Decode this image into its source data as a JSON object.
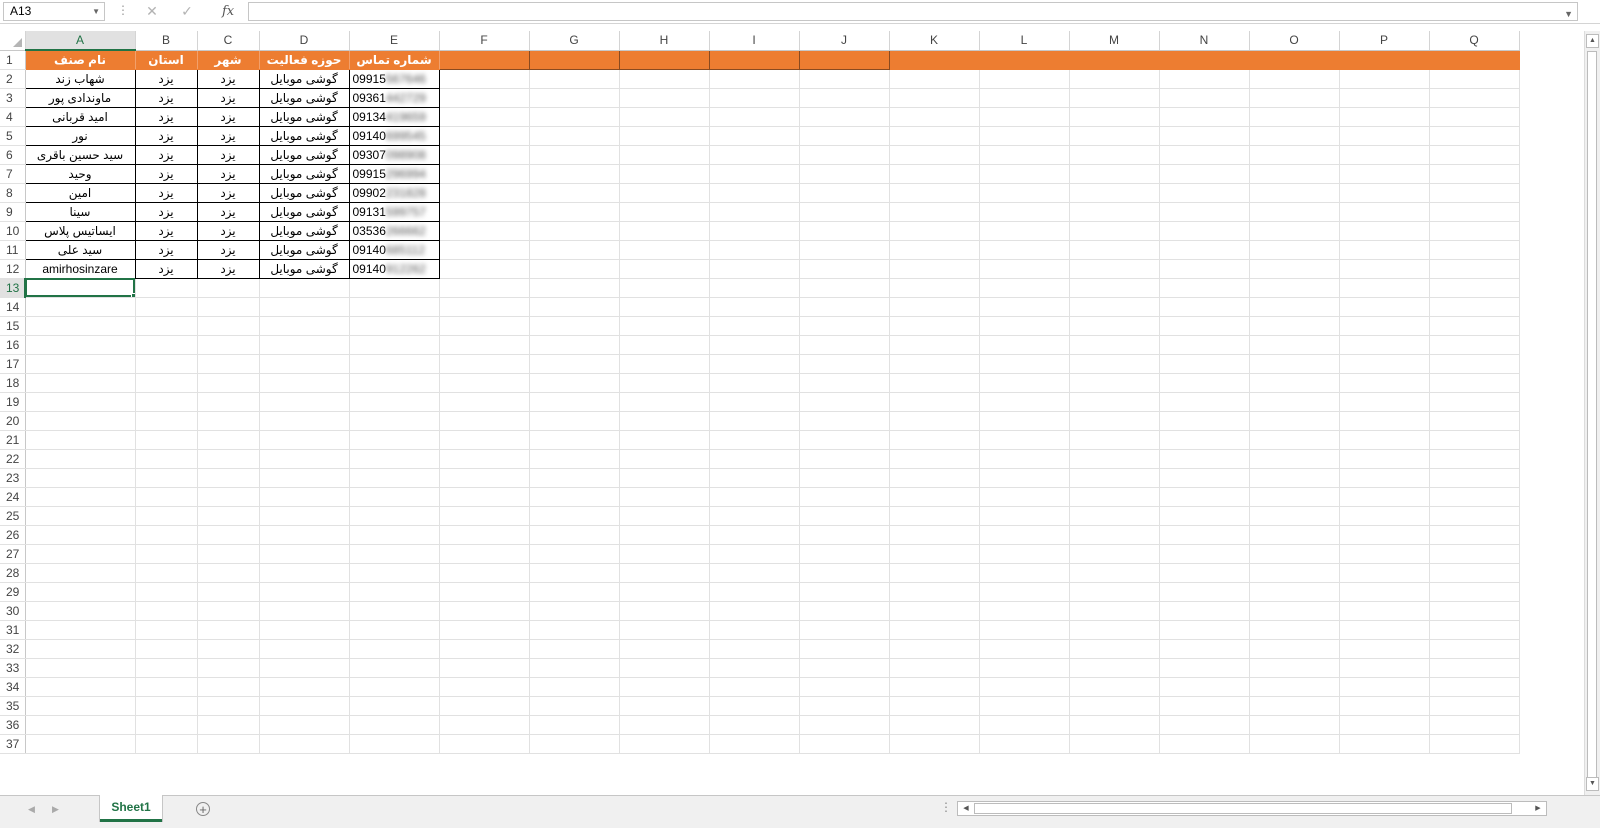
{
  "formula_bar": {
    "name_box": "A13",
    "fx_label": "fx",
    "formula": ""
  },
  "columns": [
    "A",
    "B",
    "C",
    "D",
    "E",
    "F",
    "G",
    "H",
    "I",
    "J",
    "K",
    "L",
    "M",
    "N",
    "O",
    "P",
    "Q"
  ],
  "row_numbers": [
    1,
    2,
    3,
    4,
    5,
    6,
    7,
    8,
    9,
    10,
    11,
    12,
    13,
    14,
    15,
    16,
    17,
    18,
    19,
    20,
    21,
    22,
    23,
    24,
    25,
    26,
    27,
    28,
    29,
    30,
    31,
    32,
    33,
    34,
    35,
    36,
    37
  ],
  "header_row": [
    "نام صنف",
    "استان",
    "شهر",
    "حوزه فعالیت",
    "شماره تماس"
  ],
  "rows": [
    {
      "name": "شهاب زند",
      "province": "یزد",
      "city": "یزد",
      "field": "گوشی موبایل",
      "phone_visible": "09915",
      "phone_hidden": "567646"
    },
    {
      "name": "ماوندادی پور",
      "province": "یزد",
      "city": "یزد",
      "field": "گوشی موبایل",
      "phone_visible": "09361",
      "phone_hidden": "442729"
    },
    {
      "name": "امید قربانی",
      "province": "یزد",
      "city": "یزد",
      "field": "گوشی موبایل",
      "phone_visible": "09134",
      "phone_hidden": "419659"
    },
    {
      "name": "نور",
      "province": "یزد",
      "city": "یزد",
      "field": "گوشی موبایل",
      "phone_visible": "09140",
      "phone_hidden": "699545"
    },
    {
      "name": "سید حسین باقری",
      "province": "یزد",
      "city": "یزد",
      "field": "گوشی موبایل",
      "phone_visible": "09307",
      "phone_hidden": "098908"
    },
    {
      "name": "وحید",
      "province": "یزد",
      "city": "یزد",
      "field": "گوشی موبایل",
      "phone_visible": "09915",
      "phone_hidden": "296994"
    },
    {
      "name": "امین",
      "province": "یزد",
      "city": "یزد",
      "field": "گوشی موبایل",
      "phone_visible": "09902",
      "phone_hidden": "231828"
    },
    {
      "name": "سینا",
      "province": "یزد",
      "city": "یزد",
      "field": "گوشی موبایل",
      "phone_visible": "09131",
      "phone_hidden": "599757"
    },
    {
      "name": "ایساتیس پلاس",
      "province": "یزد",
      "city": "یزد",
      "field": "گوشی موبایل",
      "phone_visible": "03536",
      "phone_hidden": "266662"
    },
    {
      "name": "سید علی",
      "province": "یزد",
      "city": "یزد",
      "field": "گوشی موبایل",
      "phone_visible": "09140",
      "phone_hidden": "685112"
    },
    {
      "name": "amirhosinzare",
      "province": "یزد",
      "city": "یزد",
      "field": "گوشی موبایل",
      "phone_visible": "09140",
      "phone_hidden": "912262"
    }
  ],
  "sheet_tabs": [
    {
      "label": "Sheet1",
      "active": true
    }
  ],
  "active_cell": "A13",
  "colors": {
    "header_fill": "#ED7D31",
    "header_text": "#FFFFFF",
    "accent": "#217346"
  }
}
